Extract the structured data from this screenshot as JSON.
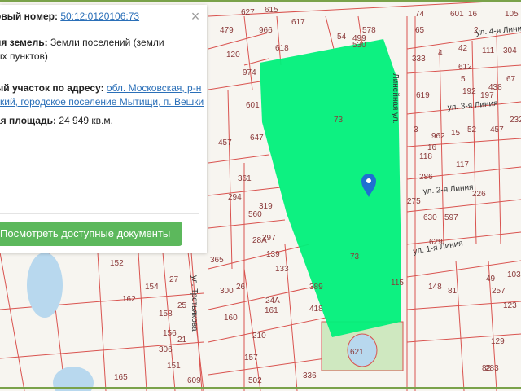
{
  "popup": {
    "cadastral_label": "овый номер:",
    "cadastral_number": "50:12:0120106:73",
    "land_category_label": "ия земель:",
    "land_category_value_1": "Земли поселений (земли",
    "land_category_value_2": "ых пунктов)",
    "address_label": "ый участок по адресу:",
    "address_line_1": "обл. Московская, р-н",
    "address_line_2": "ский, городское поселение Мытищи, п. Вешки",
    "area_label": "ая площадь:",
    "area_value": "24 949 кв.м.",
    "close_icon": "close-icon",
    "documents_button": "Посмотреть доступные документы"
  },
  "map": {
    "parcel_color": "#d9534f",
    "highlight_color": "#00f07a",
    "marker_color": "#1f6fd1",
    "marker_icon": "map-pin-icon",
    "streets": [
      "ул. 4-я Линия",
      "ул. 3-я Линия",
      "ул. 2-я Линия",
      "ул. 1-я Линия",
      "Линейная ул.",
      "ул. Третьякова"
    ],
    "parcel_numbers": [
      "479",
      "617",
      "615",
      "627",
      "966",
      "618",
      "530",
      "578",
      "54",
      "499",
      "120",
      "974",
      "601",
      "457",
      "647",
      "361",
      "294",
      "319",
      "560",
      "297",
      "28А",
      "139",
      "133",
      "365",
      "152",
      "154",
      "27",
      "162",
      "300",
      "26",
      "389",
      "24А",
      "161",
      "158",
      "25",
      "160",
      "418",
      "156",
      "210",
      "306",
      "21",
      "157",
      "151",
      "165",
      "336",
      "502",
      "609",
      "621",
      "115",
      "74",
      "65",
      "601",
      "16",
      "105",
      "333",
      "4",
      "42",
      "612",
      "111",
      "304",
      "619",
      "5",
      "192",
      "438",
      "197",
      "67",
      "3",
      "962",
      "15",
      "52",
      "457",
      "232",
      "118",
      "16",
      "117",
      "286",
      "226",
      "275",
      "630",
      "597",
      "629",
      "2",
      "148",
      "81",
      "49",
      "257",
      "123",
      "103",
      "129",
      "283",
      "82",
      "73",
      "73"
    ]
  }
}
